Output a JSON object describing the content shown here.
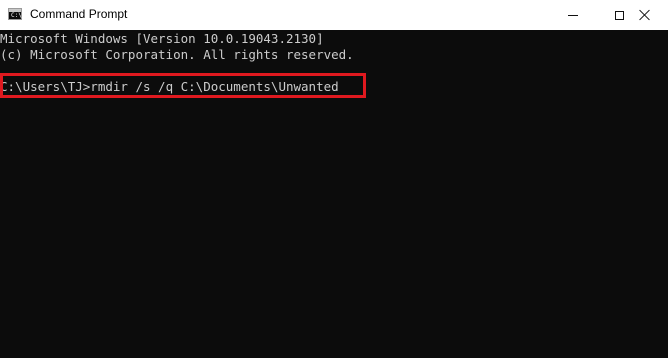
{
  "window": {
    "title": "Command Prompt",
    "icon": "cmd-icon",
    "icon_glyph": "C:\\",
    "controls": {
      "minimize": "minimize-icon",
      "maximize": "maximize-icon",
      "close": "close-icon"
    }
  },
  "console": {
    "lines": [
      "Microsoft Windows [Version 10.0.19043.2130]",
      "(c) Microsoft Corporation. All rights reserved.",
      "C:\\Users\\TJ>rmdir /s /q C:\\Documents\\Unwanted"
    ],
    "highlight_color": "#e0191f",
    "text_color": "#cccccc",
    "background_color": "#0c0c0c"
  }
}
